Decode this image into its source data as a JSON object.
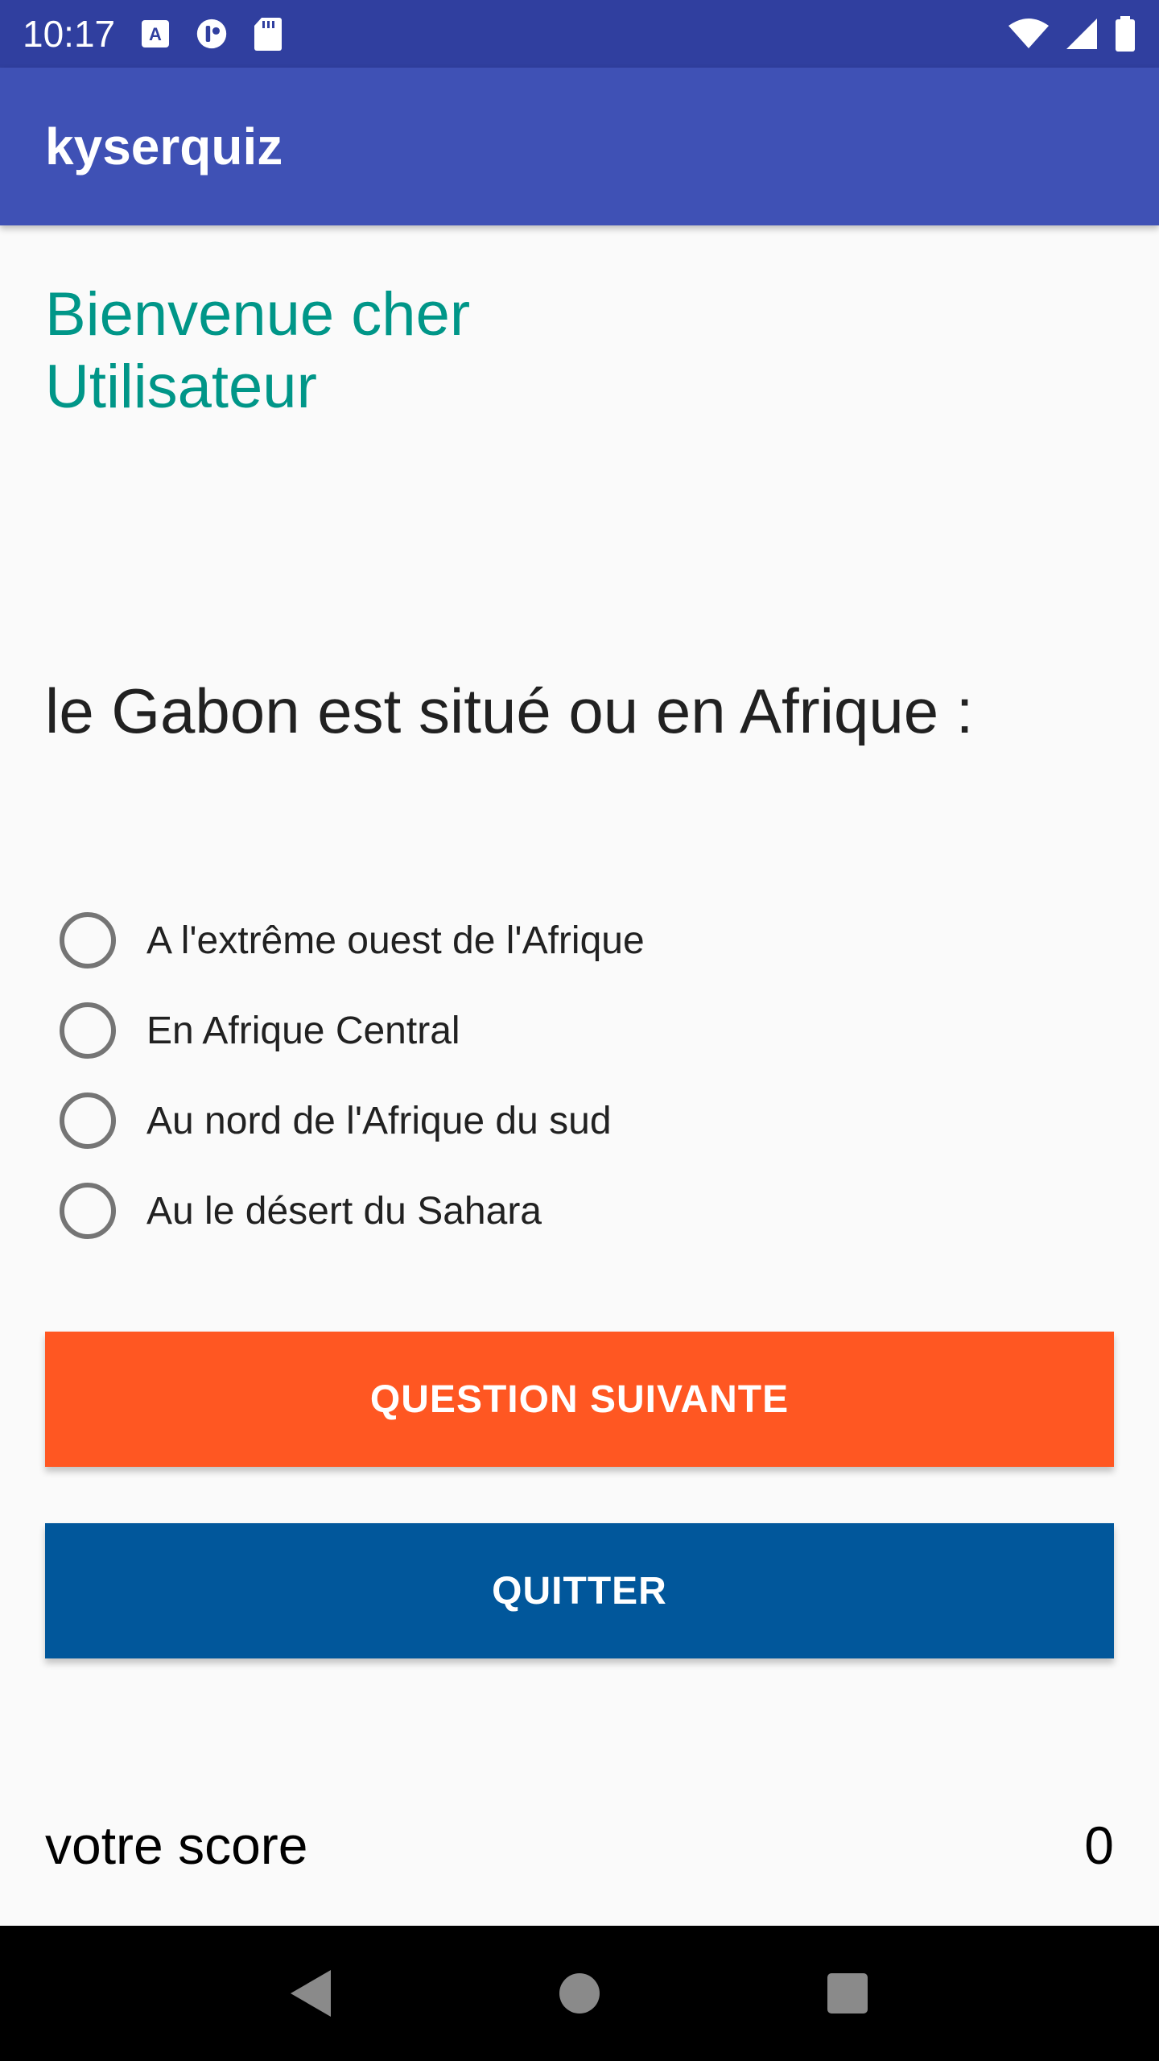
{
  "status_bar": {
    "time": "10:17",
    "icons_left": [
      "keyboard-a-icon",
      "cell-icon",
      "sd-card-icon"
    ],
    "icons_right": [
      "wifi-icon",
      "signal-icon",
      "battery-icon"
    ]
  },
  "app_bar": {
    "title": "kyserquiz"
  },
  "main": {
    "welcome": "Bienvenue cher Utilisateur",
    "question": "le Gabon est situé ou en Afrique :",
    "options": [
      {
        "label": "A l'extrême ouest de l'Afrique"
      },
      {
        "label": "En Afrique Central"
      },
      {
        "label": "Au nord de l'Afrique du sud"
      },
      {
        "label": "Au le désert du Sahara"
      }
    ],
    "next_button": "QUESTION SUIVANTE",
    "quit_button": "QUITTER",
    "score_label": "votre score",
    "score_value": "0"
  },
  "colors": {
    "status_bar": "#303f9f",
    "app_bar": "#3f51b5",
    "welcome_text": "#009688",
    "next_button": "#ff5722",
    "quit_button": "#01579b"
  },
  "nav_bar": {
    "icons": [
      "back-icon",
      "home-icon",
      "recents-icon"
    ]
  }
}
